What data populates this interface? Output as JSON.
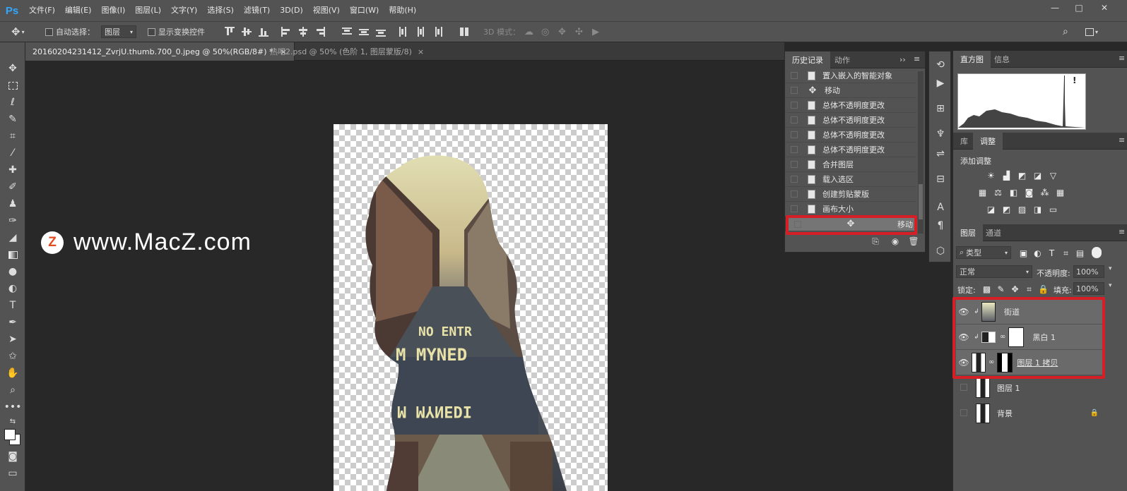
{
  "app": {
    "logo": "Ps"
  },
  "menu": [
    "文件(F)",
    "编辑(E)",
    "图像(I)",
    "图层(L)",
    "文字(Y)",
    "选择(S)",
    "滤镜(T)",
    "3D(D)",
    "视图(V)",
    "窗口(W)",
    "帮助(H)"
  ],
  "window_controls": {
    "minimize": "—",
    "maximize": "□",
    "close": "✕"
  },
  "options_bar": {
    "auto_select_label": "自动选择：",
    "auto_select_value": "图层",
    "show_transform_label": "显示变换控件",
    "mode_3d_label": "3D 模式："
  },
  "tabs": [
    {
      "title": "20160204231412_ZvrjU.thumb.700_0.jpeg @ 50%(RGB/8#) *",
      "close": "×",
      "active": true
    },
    {
      "title": "热吧2.psd @ 50% (色阶 1, 图层蒙版/8)",
      "close": "×",
      "active": false
    }
  ],
  "watermark": {
    "badge": "Z",
    "text": "www.MacZ.com"
  },
  "history_panel": {
    "tabs": [
      "历史记录",
      "动作"
    ],
    "items": [
      {
        "label": "置入嵌入的智能对象",
        "icon": "document-icon",
        "selected": false
      },
      {
        "label": "移动",
        "icon": "move-icon",
        "selected": false
      },
      {
        "label": "总体不透明度更改",
        "icon": "document-icon",
        "selected": false
      },
      {
        "label": "总体不透明度更改",
        "icon": "document-icon",
        "selected": false
      },
      {
        "label": "总体不透明度更改",
        "icon": "document-icon",
        "selected": false
      },
      {
        "label": "总体不透明度更改",
        "icon": "document-icon",
        "selected": false
      },
      {
        "label": "合并图层",
        "icon": "document-icon",
        "selected": false
      },
      {
        "label": "载入选区",
        "icon": "document-icon",
        "selected": false
      },
      {
        "label": "创建剪贴蒙版",
        "icon": "document-icon",
        "selected": false
      },
      {
        "label": "画布大小",
        "icon": "document-icon",
        "selected": false
      },
      {
        "label": "移动",
        "icon": "move-icon",
        "selected": true
      }
    ]
  },
  "histogram_panel": {
    "tabs": [
      "直方图",
      "信息"
    ],
    "warning": "!"
  },
  "adjustments_panel": {
    "tabs": [
      "库",
      "调整"
    ],
    "title": "添加调整"
  },
  "layers_panel": {
    "tabs": [
      "图层",
      "通道"
    ],
    "filter_label": "类型",
    "blend_mode": "正常",
    "opacity_label": "不透明度:",
    "opacity_value": "100%",
    "lock_label": "锁定:",
    "fill_label": "填充:",
    "fill_value": "100%",
    "layers": [
      {
        "name": "街道",
        "visible": true,
        "clipped": true,
        "highlighted": true
      },
      {
        "name": "黑白 1",
        "visible": true,
        "clipped": true,
        "highlighted": true
      },
      {
        "name": "图层 1 拷贝",
        "visible": true,
        "clipped": false,
        "highlighted": true
      },
      {
        "name": "图层 1",
        "visible": false,
        "clipped": false,
        "highlighted": false
      },
      {
        "name": "背景",
        "visible": false,
        "clipped": false,
        "highlighted": false,
        "locked": true
      }
    ]
  },
  "colors": {
    "highlight_box": "#d61e26",
    "ps_blue": "#31a8ff",
    "panel_bg": "#535353",
    "canvas_bg": "#282828"
  }
}
